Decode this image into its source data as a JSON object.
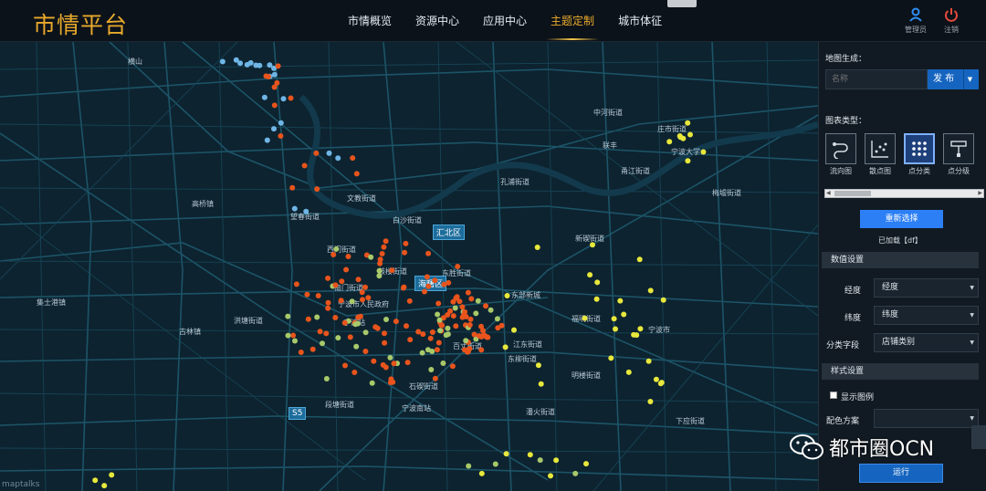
{
  "header": {
    "logo": "市情平台",
    "nav": [
      "市情概览",
      "资源中心",
      "应用中心",
      "主题定制",
      "城市体征"
    ],
    "active_nav": 3,
    "user_label": "管理员",
    "logout_label": "注销"
  },
  "panel": {
    "map_gen_label": "地图生成：",
    "name_placeholder": "名称",
    "publish_label": "发 布",
    "chart_type_label": "图表类型：",
    "chart_types": [
      {
        "label": "流向图",
        "icon": "flow-icon"
      },
      {
        "label": "散点图",
        "icon": "scatter-icon"
      },
      {
        "label": "点分类",
        "icon": "grid-dots-icon"
      },
      {
        "label": "点分级",
        "icon": "level-icon"
      }
    ],
    "active_chart_type": 2,
    "reselect_label": "重新选择",
    "loaded_text": "已加载【df】",
    "value_settings_label": "数值设置",
    "longitude_label": "经度",
    "longitude_value": "经度",
    "latitude_label": "纬度",
    "latitude_value": "纬度",
    "category_field_label": "分类字段",
    "category_field_value": "店铺类别",
    "style_settings_label": "样式设置",
    "show_legend_label": "显示图例",
    "color_scheme_label": "配色方案",
    "run_label": "运行"
  },
  "map": {
    "attribution": "maptalks",
    "labels": [
      "宁波市人民政府",
      "海曙区",
      "汇北区",
      "白沙街道",
      "文教街道",
      "望春街道",
      "西门街道",
      "南门街道",
      "宁波站",
      "鼓楼街道",
      "东部新城",
      "东胜街道",
      "江东街道",
      "百丈街道",
      "宁波大学",
      "孔浦街道",
      "庄市街道",
      "集士港镇",
      "高桥镇",
      "古林镇",
      "石碶街道",
      "段塘街道",
      "福明街道",
      "潘火街道",
      "宁波南站",
      "洪塘街道",
      "新碶街道",
      "横山",
      "宁波市",
      "联丰",
      "甬江街道",
      "明楼街道",
      "东柳街道",
      "中河街道",
      "梅墟街道",
      "下应街道"
    ],
    "badges": {
      "s5": "S5"
    },
    "colors": {
      "category_a": "#e8541c",
      "category_b": "#a8c96a",
      "category_c": "#e8e83c",
      "category_d": "#6fb6e6"
    }
  },
  "watermark": "都市圈OCN"
}
